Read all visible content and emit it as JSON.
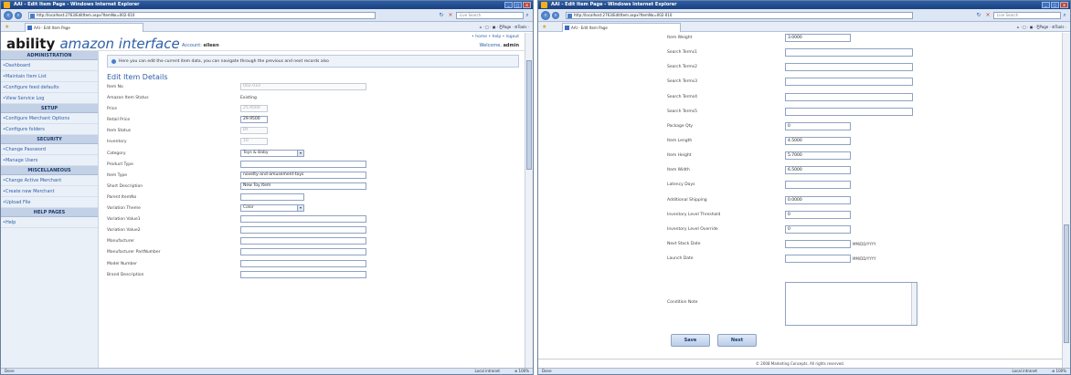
{
  "browser": {
    "window_title": "AAI - Edit Item Page - Windows Internet Explorer",
    "address": "http://localhost:2763/EditItem.aspx?ItemNo=002-010",
    "search_placeholder": "Live Search",
    "tab_title": "AAI - Edit Item Page",
    "tools": "⌂ · □ · ▣ · ⎗Page · ⚙Tools ·",
    "status_left": "Done",
    "status_zone": "Local intranet",
    "status_zoom": "⊕ 100%"
  },
  "header": {
    "brand_bold": "ability",
    "brand_italic": "amazon interface",
    "account_label": "Account:",
    "account_name": "elleen",
    "toplinks": "• home • help • logout",
    "welcome_label": "Welcome,",
    "welcome_name": "admin"
  },
  "sidebar": {
    "sections": [
      {
        "title": "ADMINISTRATION",
        "items": [
          "Dashboard",
          "Maintain Item List",
          "Configure feed defaults",
          "View Service Log"
        ]
      },
      {
        "title": "SETUP",
        "items": [
          "Configure Merchant Options",
          "Configure folders"
        ]
      },
      {
        "title": "SECURITY",
        "items": [
          "Change Password",
          "Manage Users"
        ]
      },
      {
        "title": "MISCELLANEOUS",
        "items": [
          "Change Active Merchant",
          "Create new Merchant",
          "Upload File"
        ]
      },
      {
        "title": "HELP PAGES",
        "items": [
          "Help"
        ]
      }
    ]
  },
  "main": {
    "info_text": "Here you can edit the current item data, you can navigate through the previous and next records also",
    "section_title": "Edit Item Details",
    "fields": [
      {
        "label": "Item No",
        "value": "002-010",
        "kind": "disabled",
        "w": 138
      },
      {
        "label": "Amazon Item Status",
        "value": "Existing",
        "kind": "text"
      },
      {
        "label": "Price",
        "value": "25.9500",
        "kind": "disabled",
        "w": 30
      },
      {
        "label": "Retail Price",
        "value": "29.9500",
        "kind": "input",
        "w": 30
      },
      {
        "label": "Item Status",
        "value": "BY",
        "kind": "disabled",
        "w": 30
      },
      {
        "label": "Inventory",
        "value": "10",
        "kind": "disabled",
        "w": 30
      },
      {
        "label": "Category",
        "value": "Toys & Baby",
        "kind": "select",
        "w": 70
      },
      {
        "label": "Product Type",
        "value": "",
        "kind": "input",
        "w": 138
      },
      {
        "label": "Item Type",
        "value": "novelty-and-amusement-toys",
        "kind": "input",
        "w": 138
      },
      {
        "label": "Short Description",
        "value": "New Toy Item",
        "kind": "input",
        "w": 138
      },
      {
        "label": "Parent ItemNo",
        "value": "",
        "kind": "input",
        "w": 70
      },
      {
        "label": "Variation Theme",
        "value": "Color",
        "kind": "select",
        "w": 70
      },
      {
        "label": "Variation Value1",
        "value": "",
        "kind": "input",
        "w": 138
      },
      {
        "label": "Variation Value2",
        "value": "",
        "kind": "input",
        "w": 138
      },
      {
        "label": "Manufacturer",
        "value": "",
        "kind": "input",
        "w": 138
      },
      {
        "label": "Manufacturer PartNumber",
        "value": "",
        "kind": "input",
        "w": 138
      },
      {
        "label": "Model Number",
        "value": "",
        "kind": "input",
        "w": 138
      },
      {
        "label": "Brand Description",
        "value": "",
        "kind": "input",
        "w": 138
      }
    ]
  },
  "right": {
    "fields": [
      {
        "label": "Item Weight",
        "value": "3.0000",
        "w": 72
      },
      {
        "label": "Search Terms1",
        "value": "",
        "w": 140
      },
      {
        "label": "Search Terms2",
        "value": "",
        "w": 140
      },
      {
        "label": "Search Terms3",
        "value": "",
        "w": 140
      },
      {
        "label": "Search Terms4",
        "value": "",
        "w": 140
      },
      {
        "label": "Search Terms5",
        "value": "",
        "w": 140
      },
      {
        "label": "Package Qty",
        "value": "0",
        "w": 72
      },
      {
        "label": "Item Length",
        "value": "4.5000",
        "w": 72
      },
      {
        "label": "Item Height",
        "value": "5.7000",
        "w": 72
      },
      {
        "label": "Item Width",
        "value": "6.5000",
        "w": 72
      },
      {
        "label": "Latency Days",
        "value": "",
        "w": 72
      },
      {
        "label": "Additional Shipping",
        "value": "0.0000",
        "w": 72
      },
      {
        "label": "Inventory Level Threshold",
        "value": "0",
        "w": 72
      },
      {
        "label": "Inventory Level Override",
        "value": "0",
        "w": 72
      },
      {
        "label": "Next Stock Date",
        "value": "",
        "w": 72,
        "fmt": "MM/DD/YYYY"
      },
      {
        "label": "Launch Date",
        "value": "",
        "w": 72,
        "fmt": "MM/DD/YYYY"
      }
    ],
    "condition_label": "Condition Note",
    "save_label": "Save",
    "next_label": "Next",
    "copyright": "© 2008 Marketing Concepts. All rights reserved."
  }
}
